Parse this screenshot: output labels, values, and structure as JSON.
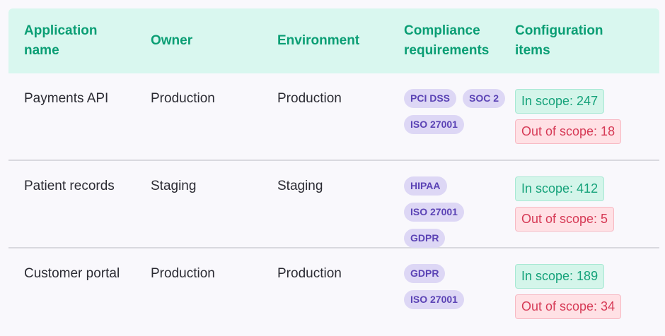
{
  "headers": [
    "Application name",
    "Owner",
    "Environment",
    "Compliance requirements",
    "Configuration items"
  ],
  "rows": [
    {
      "app": "Payments API",
      "owner": "Production",
      "environment": "Production",
      "tags": [
        "PCI DSS",
        "SOC 2",
        "ISO 27001"
      ],
      "in_scope": "In scope: 247",
      "out_scope": "Out of scope: 18"
    },
    {
      "app": "Patient records",
      "owner": "Staging",
      "environment": "Staging",
      "tags": [
        "HIPAA",
        "ISO 27001",
        "GDPR"
      ],
      "in_scope": "In scope: 412",
      "out_scope": "Out of scope: 5"
    },
    {
      "app": "Customer portal",
      "owner": "Production",
      "environment": "Production",
      "tags": [
        "GDPR",
        "ISO 27001"
      ],
      "in_scope": "In scope: 189",
      "out_scope": "Out of scope: 34"
    }
  ],
  "colors": {
    "header_bg": "#d9f7ef",
    "header_text": "#0a9e74",
    "tag_bg": "#ddd7f5",
    "tag_text": "#5b43b5",
    "in_scope_text": "#15a27a",
    "out_scope_text": "#d63955"
  }
}
